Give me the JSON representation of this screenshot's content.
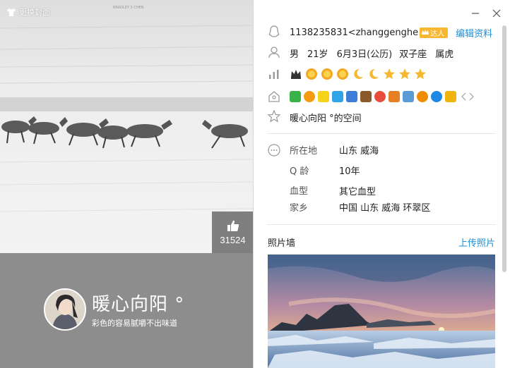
{
  "cover": {
    "change_cover_label": "更换封面",
    "watermark": "BRADLEY S CHEN",
    "likes": "31524",
    "nickname": "暖心向阳 °",
    "signature": "彩色的容易腻嚼不出味道"
  },
  "profile": {
    "qq_id": "1138235831<zhanggenghe",
    "vip_badge": "达人",
    "edit_label": "编辑资料",
    "gender": "男",
    "age": "21岁",
    "birthday": "6月3日(公历)",
    "zodiac": "双子座",
    "chinese_zodiac": "属虎",
    "space_label": "暖心向阳 °的空间",
    "details": [
      {
        "label": "所在地",
        "value": "山东 威海"
      },
      {
        "label": "Q 龄",
        "value": "10年"
      },
      {
        "label": "血型",
        "value": "其它血型"
      },
      {
        "label": "家乡",
        "value": "中国 山东 威海 环翠区"
      }
    ],
    "photo_wall_label": "照片墙",
    "upload_label": "上传照片"
  },
  "level_icons": [
    "crown-icon",
    "sun-icon",
    "sun-icon",
    "sun-icon",
    "moon-icon",
    "moon-icon",
    "star-icon",
    "star-icon",
    "star-icon"
  ],
  "service_icons": [
    "qq-vip-icon",
    "qq-game-icon",
    "qq-star-icon",
    "qq-app-icon",
    "qq-photo-icon",
    "qq-farm-icon",
    "qq-eye-icon",
    "qq-pet-icon",
    "qq-mail-icon",
    "qq-music-icon",
    "qq-penguin-icon",
    "qq-wallet-icon"
  ],
  "colors": {
    "accent": "#1c8fd6",
    "gold": "#f5a623",
    "band": "#8d8d8d"
  }
}
